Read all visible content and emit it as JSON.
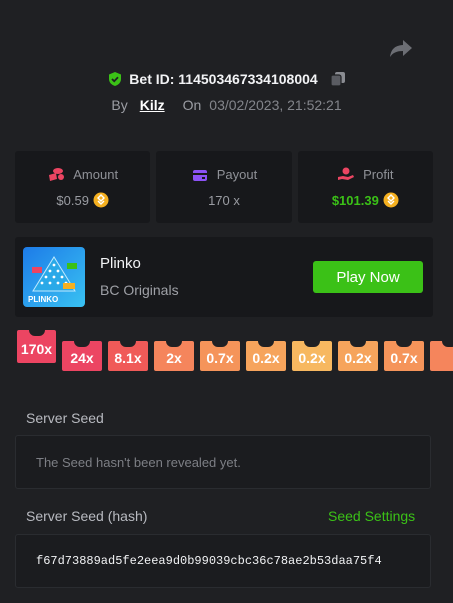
{
  "bet": {
    "id_label": "Bet ID: 114503467334108004",
    "by_label": "By",
    "user": "Kilz",
    "on_label": "On",
    "date": "03/02/2023, 21:52:21"
  },
  "stats": [
    {
      "label": "Amount",
      "value": "$0.59",
      "icon": "coins-icon"
    },
    {
      "label": "Payout",
      "value": "170 x",
      "icon": "wallet-icon"
    },
    {
      "label": "Profit",
      "value": "$101.39",
      "icon": "hand-coin-icon"
    }
  ],
  "game": {
    "name": "Plinko",
    "provider": "BC Originals",
    "play_label": "Play Now",
    "thumb_text": "PLINKO"
  },
  "multipliers": [
    "170x",
    "24x",
    "8.1x",
    "2x",
    "0.7x",
    "0.2x",
    "0.2x",
    "0.2x",
    "0.7x"
  ],
  "seeds": {
    "server_seed_label": "Server Seed",
    "server_seed_value": "The Seed hasn't been revealed yet.",
    "hash_label": "Server Seed (hash)",
    "seed_settings_label": "Seed Settings",
    "hash_value": "f67d73889ad5fe2eea9d0b99039cbc36c78ae2b53daa75f4"
  },
  "colors": {
    "accent_green": "#3bc117",
    "coin": "#f5b020",
    "mult_red": "#ec4562",
    "mult_orange": "#f5855c",
    "mult_yellow": "#f7b860"
  }
}
